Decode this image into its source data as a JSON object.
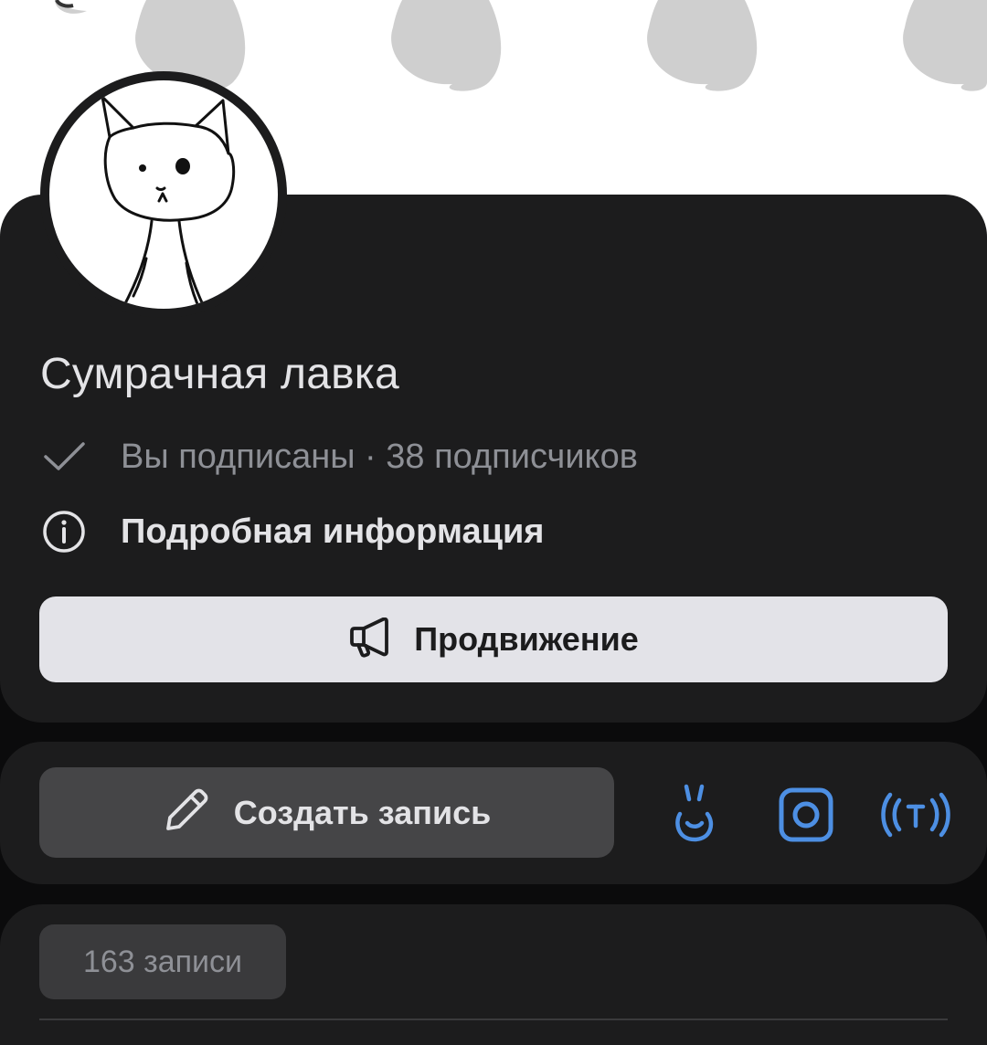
{
  "community": {
    "name": "Сумрачная лавка",
    "subscription_status": "Вы подписаны · 38 подписчиков",
    "details_link": "Подробная информация"
  },
  "buttons": {
    "promote": "Продвижение",
    "create_post": "Создать запись"
  },
  "social_links": [
    {
      "name": "vk-rabbit-icon"
    },
    {
      "name": "instagram-icon"
    },
    {
      "name": "telegram-broadcast-icon"
    }
  ],
  "posts": {
    "count_label": "163 записи"
  },
  "colors": {
    "background": "#0b0b0c",
    "card": "#1c1c1d",
    "accent": "#4d8fe3",
    "primary_text": "#e3e3e6",
    "secondary_text": "#8e9096",
    "promo_button": "#e3e3e8",
    "create_button": "#454547"
  }
}
